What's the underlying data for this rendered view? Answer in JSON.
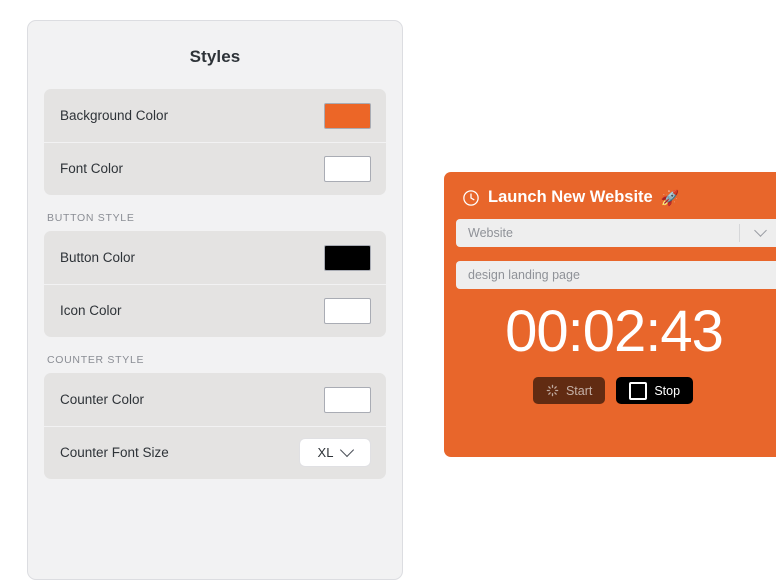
{
  "panel": {
    "title": "Styles",
    "sections": [
      {
        "label": "",
        "rows": [
          {
            "label": "Background Color",
            "control": "swatch",
            "color": "#ec6627"
          },
          {
            "label": "Font Color",
            "control": "swatch",
            "color": "#ffffff"
          }
        ]
      },
      {
        "label": "BUTTON STYLE",
        "rows": [
          {
            "label": "Button Color",
            "control": "swatch",
            "color": "#000000"
          },
          {
            "label": "Icon Color",
            "control": "swatch",
            "color": "#ffffff"
          }
        ]
      },
      {
        "label": "COUNTER STYLE",
        "rows": [
          {
            "label": "Counter Color",
            "control": "swatch",
            "color": "#ffffff"
          },
          {
            "label": "Counter Font Size",
            "control": "select",
            "value": "XL"
          }
        ]
      }
    ]
  },
  "widget": {
    "header_title": "Launch New Website",
    "header_emoji": "🚀",
    "clock_icon": "clock-icon",
    "rocket_icon": "rocket-icon",
    "category_select": {
      "value": "Website",
      "chevron_icon": "chevron-down-icon"
    },
    "task_input": {
      "value": "design landing page",
      "placeholder": "design landing page"
    },
    "timer": "00:02:43",
    "buttons": {
      "start": {
        "label": "Start",
        "icon": "spinner-icon",
        "state": "disabled"
      },
      "stop": {
        "label": "Stop",
        "icon": "stop-square-icon",
        "state": "active"
      }
    },
    "background_color": "#e8662b"
  }
}
